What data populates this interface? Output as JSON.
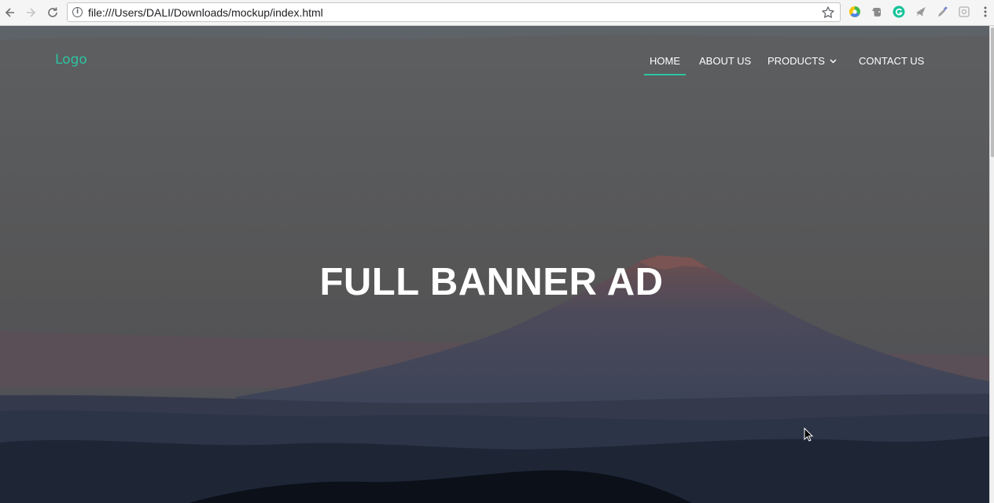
{
  "browser": {
    "url": "file:///Users/DALI/Downloads/mockup/index.html",
    "extensions": [
      "chrome-color-icon",
      "evernote-icon",
      "grammarly-icon",
      "bird-icon",
      "eyedropper-icon",
      "extension-puzzle-icon"
    ]
  },
  "site": {
    "logo": "Logo",
    "nav": {
      "home": "HOME",
      "about": "ABOUT US",
      "products": "PRODUCTS",
      "contact": "CONTACT US"
    },
    "active_nav": "home"
  },
  "hero": {
    "title": "FULL BANNER AD"
  },
  "colors": {
    "accent": "#2ec4a0",
    "overlay": "#565656",
    "text": "#ffffff"
  }
}
